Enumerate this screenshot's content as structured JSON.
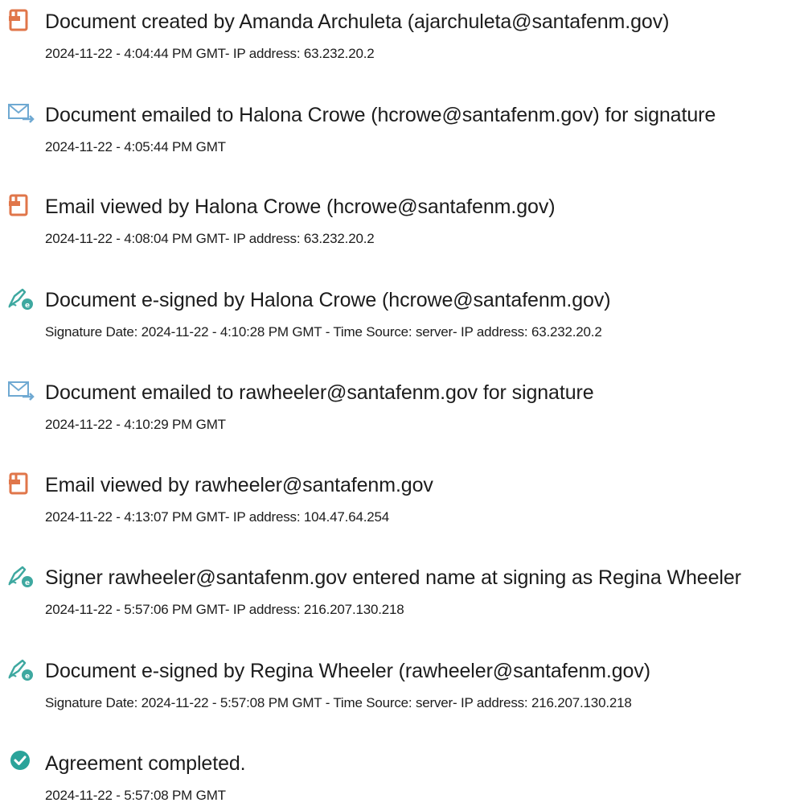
{
  "colors": {
    "document_icon": "#e0764a",
    "email_icon": "#6fa9d2",
    "sign_icon": "#3ea8a0",
    "complete_icon": "#2aa39a",
    "text": "#1c1c1c"
  },
  "events": [
    {
      "icon": "document-icon",
      "title": "Document created by Amanda Archuleta (ajarchuleta@santafenm.gov)",
      "detail": "2024-11-22 - 4:04:44 PM GMT- IP address: 63.232.20.2"
    },
    {
      "icon": "email-icon",
      "title": "Document emailed to Halona Crowe (hcrowe@santafenm.gov) for signature",
      "detail": "2024-11-22 - 4:05:44 PM GMT"
    },
    {
      "icon": "document-icon",
      "title": "Email viewed by Halona Crowe (hcrowe@santafenm.gov)",
      "detail": "2024-11-22 - 4:08:04 PM GMT- IP address: 63.232.20.2"
    },
    {
      "icon": "signature-pen-icon",
      "title": "Document e-signed by Halona Crowe (hcrowe@santafenm.gov)",
      "detail": "Signature Date: 2024-11-22 - 4:10:28 PM GMT - Time Source: server- IP address: 63.232.20.2"
    },
    {
      "icon": "email-icon",
      "title": "Document emailed to rawheeler@santafenm.gov for signature",
      "detail": "2024-11-22 - 4:10:29 PM GMT"
    },
    {
      "icon": "document-icon",
      "title": "Email viewed by rawheeler@santafenm.gov",
      "detail": "2024-11-22 - 4:13:07 PM GMT- IP address: 104.47.64.254"
    },
    {
      "icon": "signature-pen-icon",
      "title": "Signer rawheeler@santafenm.gov entered name at signing as Regina Wheeler",
      "detail": "2024-11-22 - 5:57:06 PM GMT- IP address: 216.207.130.218"
    },
    {
      "icon": "signature-pen-icon",
      "title": "Document e-signed by Regina Wheeler (rawheeler@santafenm.gov)",
      "detail": "Signature Date: 2024-11-22 - 5:57:08 PM GMT - Time Source: server- IP address: 216.207.130.218"
    },
    {
      "icon": "checkmark-circle-icon",
      "title": "Agreement completed.",
      "detail": "2024-11-22 - 5:57:08 PM GMT"
    }
  ]
}
